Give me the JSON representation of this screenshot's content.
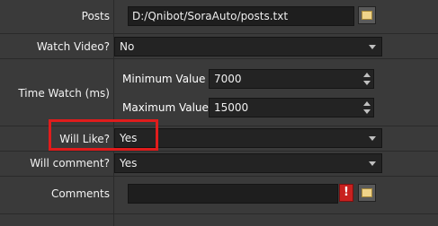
{
  "posts": {
    "label": "Posts",
    "value": "D:/Qnibot/SoraAuto/posts.txt"
  },
  "watch_video": {
    "label": "Watch Video?",
    "value": "No"
  },
  "time_watch": {
    "label": "Time Watch (ms)",
    "minimum_label": "Minimum Value",
    "minimum_value": "7000",
    "maximum_label": "Maximum Value",
    "maximum_value": "15000"
  },
  "will_like": {
    "label": "Will Like?",
    "value": "Yes"
  },
  "will_comment": {
    "label": "Will comment?",
    "value": "Yes"
  },
  "comments": {
    "label": "Comments",
    "value": "",
    "warning_glyph": "!"
  },
  "colors": {
    "highlight": "#e01c1c",
    "background": "#3a3a3a",
    "warning": "#c8211f"
  }
}
